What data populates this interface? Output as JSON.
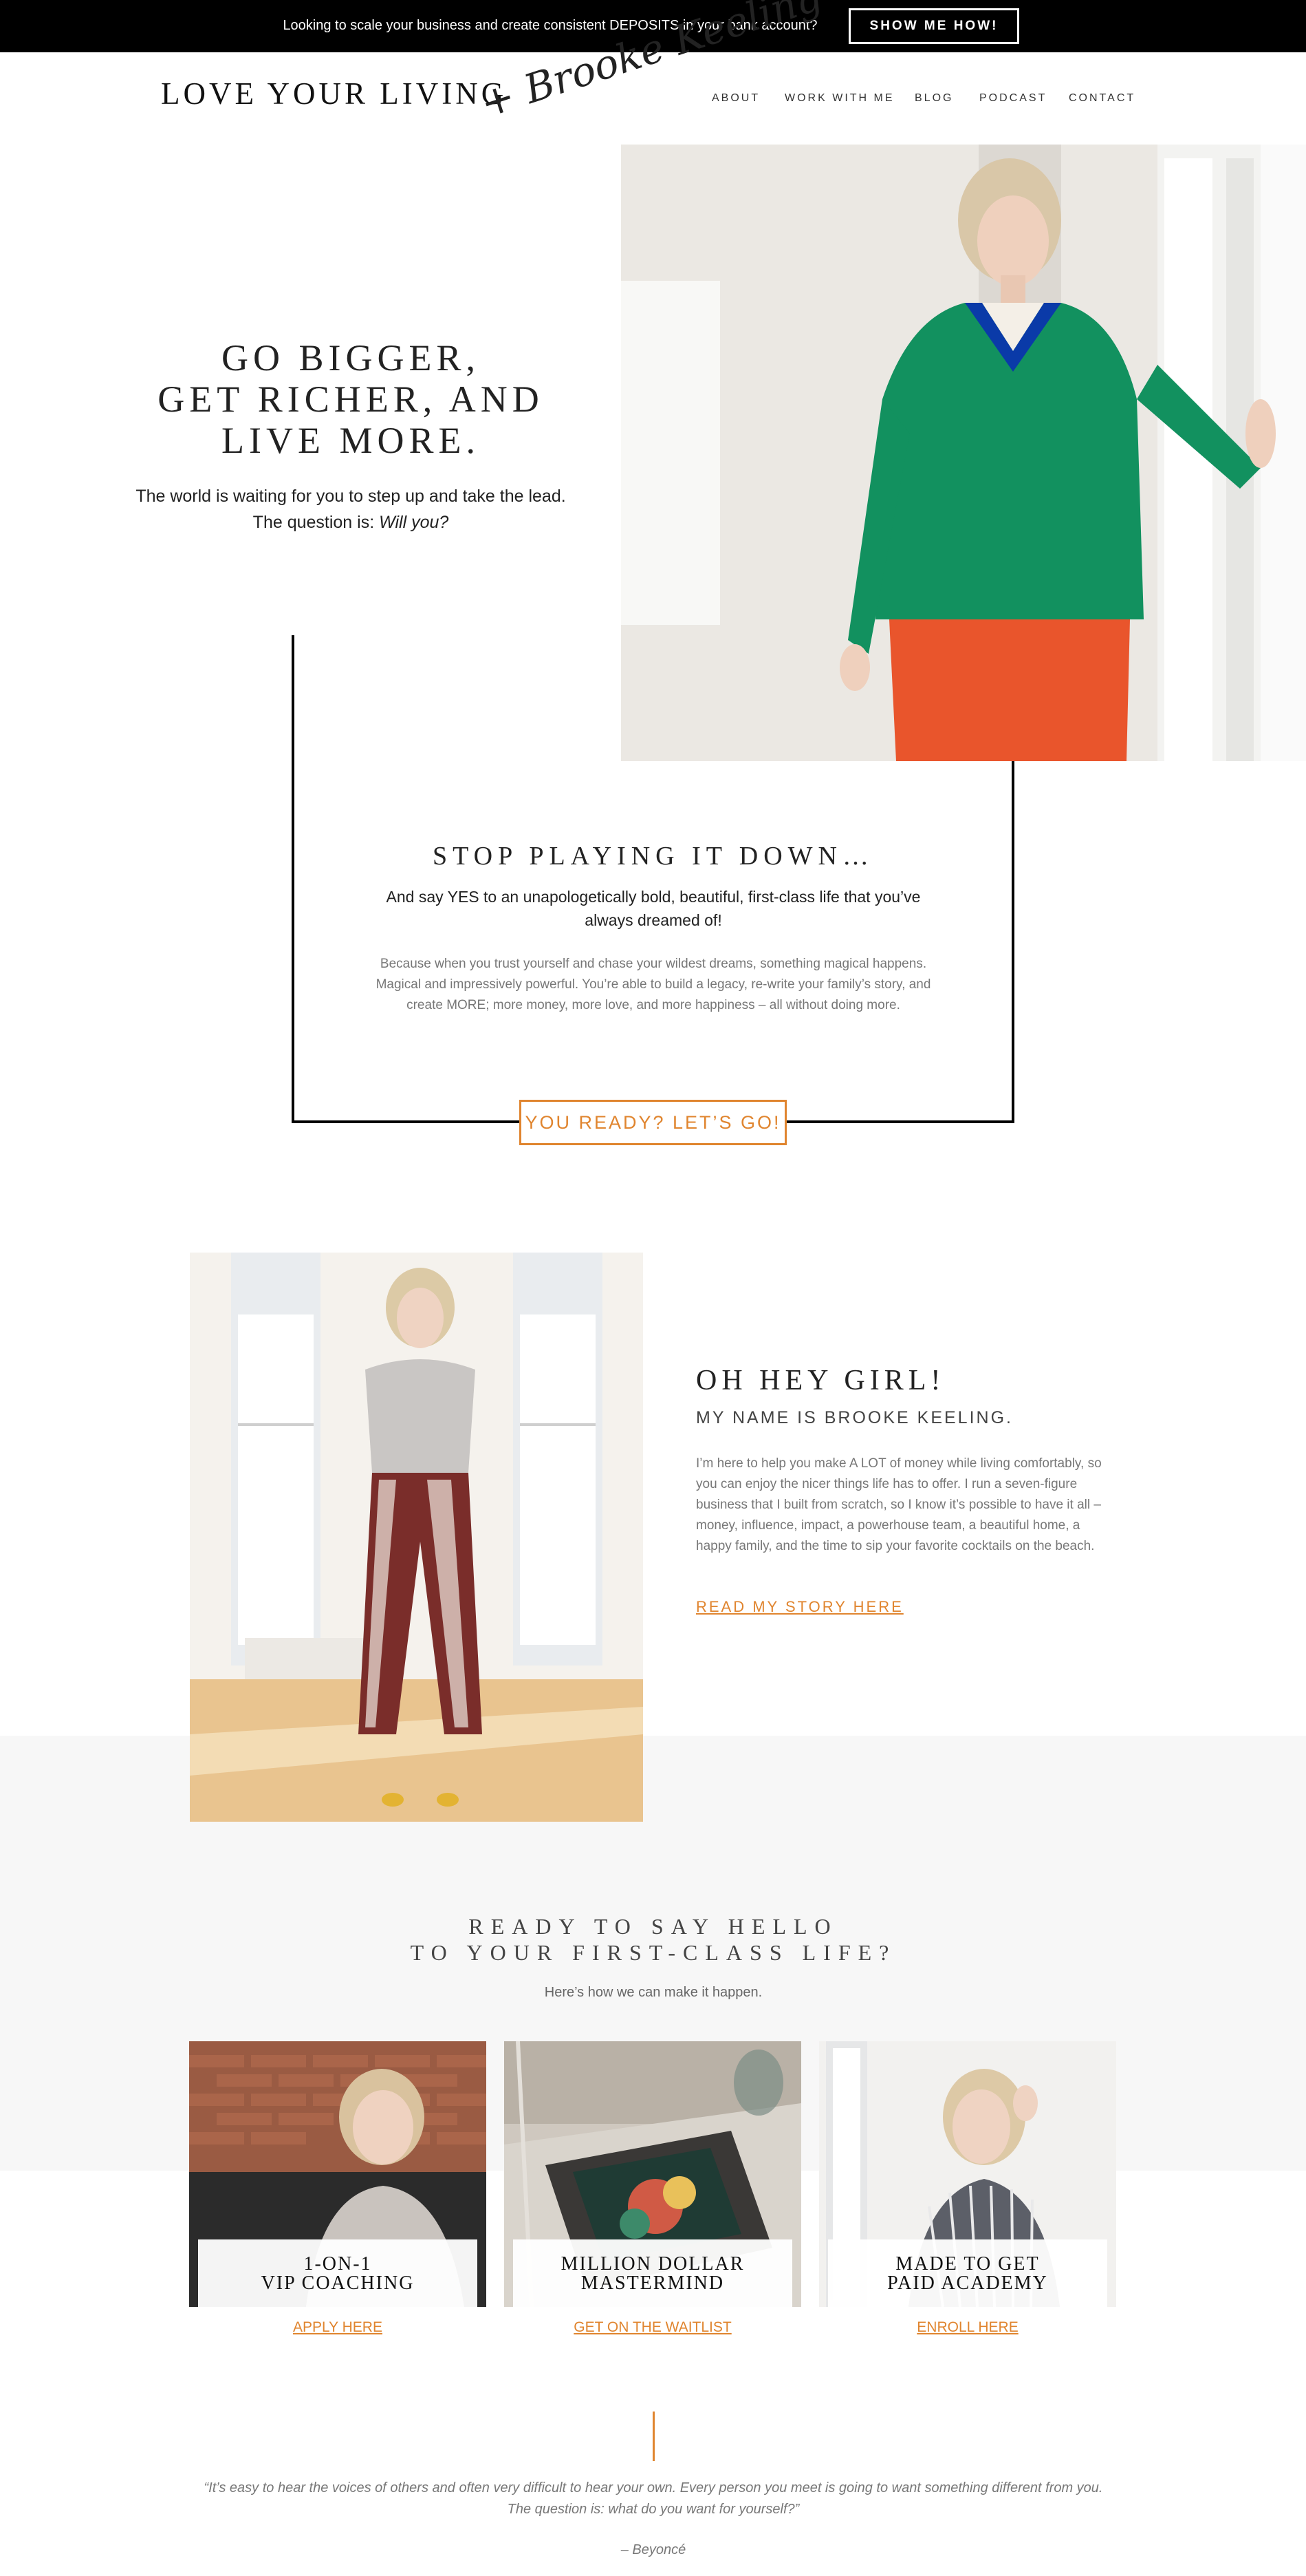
{
  "topbar": {
    "text": "Looking to scale your business and create consistent DEPOSITS in your bank account?",
    "button": "SHOW ME HOW!"
  },
  "header": {
    "logo_main": "LOVE YOUR LIVING",
    "logo_script": "+ Brooke Keeling",
    "nav": [
      "ABOUT",
      "WORK WITH ME",
      "BLOG",
      "PODCAST",
      "CONTACT"
    ]
  },
  "hero": {
    "title_lines": [
      "GO BIGGER,",
      "GET RICHER, AND",
      "LIVE MORE."
    ],
    "sub_line1": "The world is waiting for you to step up and take the lead.",
    "sub_line2_prefix": "The question is: ",
    "sub_line2_em": "Will you?"
  },
  "stop": {
    "title": "STOP PLAYING IT DOWN…",
    "subtitle": "And say YES to an unapologetically bold, beautiful, first-class life that you’ve always dreamed of!",
    "body": "Because when you trust yourself and chase your wildest dreams, something magical happens. Magical and impressively powerful. You’re able to build a legacy, re-write your family’s story, and create MORE; more money, more love, and more happiness – all without doing more.",
    "cta": "YOU READY? LET’S GO!"
  },
  "about": {
    "title": "OH HEY GIRL!",
    "subtitle": "MY NAME IS BROOKE KEELING.",
    "body": "I’m here to help you make A LOT of money while living comfortably, so you can enjoy the nicer things life has to offer. I run a seven-figure business that I built from scratch, so I know it’s possible to have it all – money, influence, impact, a powerhouse team, a beautiful home, a happy family, and the time to sip your favorite cocktails on the beach.",
    "link": "READ MY STORY HERE"
  },
  "ready": {
    "title_line1": "READY TO SAY HELLO",
    "title_line2": "TO YOUR FIRST-CLASS LIFE?",
    "subtitle": "Here’s how we can make it happen.",
    "cards": [
      {
        "line1": "1-ON-1",
        "line2": "VIP COACHING",
        "link": "APPLY HERE"
      },
      {
        "line1": "MILLION DOLLAR",
        "line2": "MASTERMIND",
        "link": "GET ON THE WAITLIST"
      },
      {
        "line1": "MADE TO GET",
        "line2": "PAID ACADEMY",
        "link": "ENROLL HERE"
      }
    ]
  },
  "quote": {
    "text_line1": "“It’s easy to hear the voices of others and often very difficult to hear your own. Every person you meet is going to want something different from you.",
    "text_line2": "The question is: what do you want for yourself?”",
    "author": "– Beyoncé"
  },
  "colors": {
    "accent": "#e0852f",
    "topbar_bg": "#000000",
    "band_gray": "#f7f7f7",
    "text_dark": "#222222",
    "text_muted": "#777777"
  }
}
